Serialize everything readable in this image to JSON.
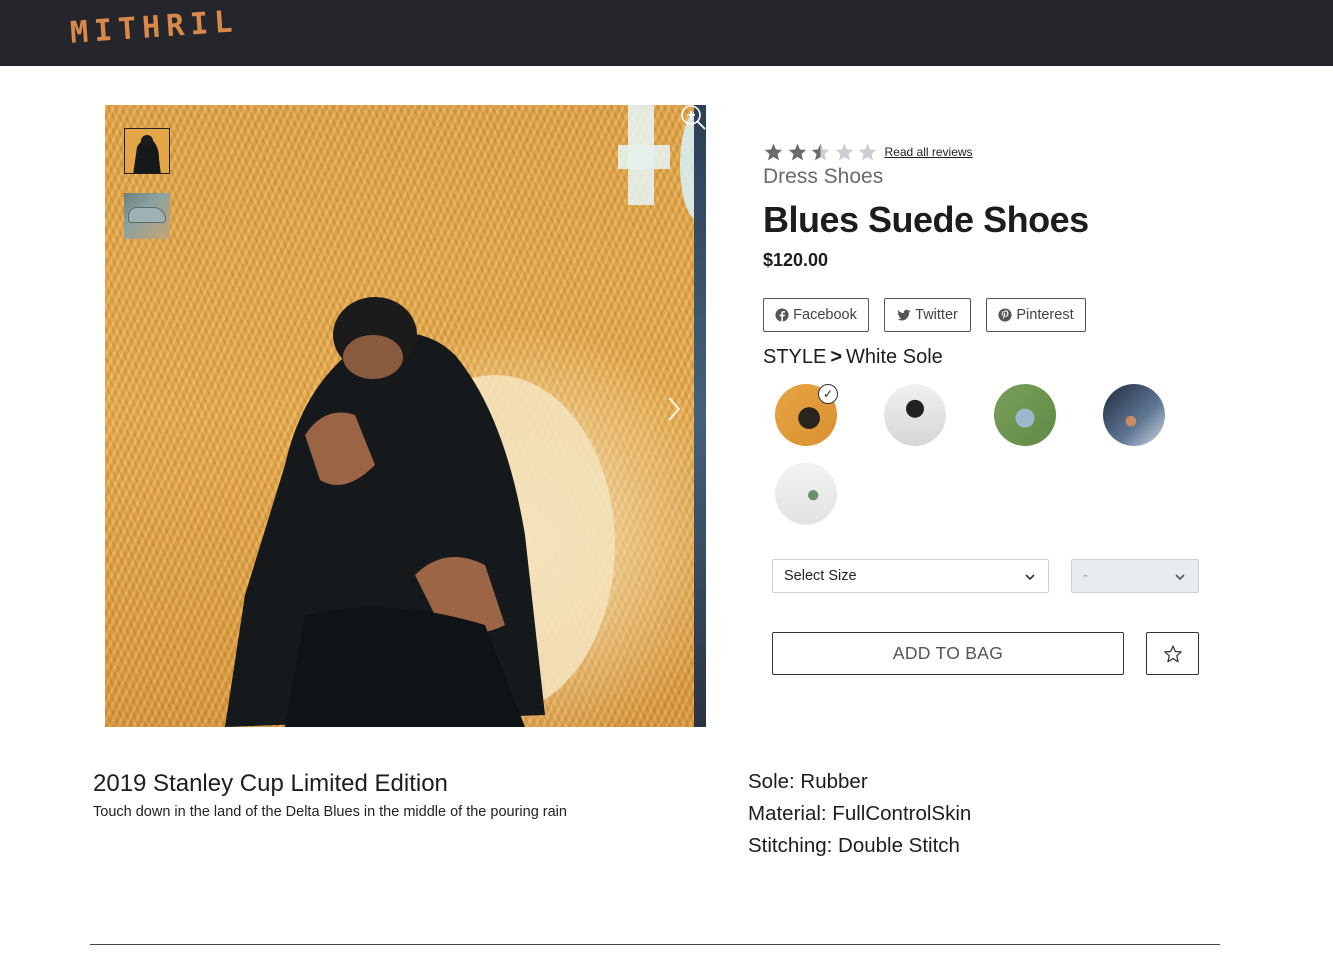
{
  "header": {
    "logo_text": "MITHRIL"
  },
  "gallery": {
    "thumbnails": [
      "thumbnail-person",
      "thumbnail-shoe"
    ],
    "zoom_icon": "zoom-in-icon",
    "next_icon": "chevron-right-icon"
  },
  "product": {
    "rating": 2.5,
    "rating_max": 5,
    "reviews_link": "Read all reviews",
    "category": "Dress Shoes",
    "name": "Blues Suede Shoes",
    "price": "$120.00"
  },
  "share": {
    "facebook": "Facebook",
    "twitter": "Twitter",
    "pinterest": "Pinterest"
  },
  "style": {
    "label": "STYLE",
    "separator": ">",
    "selected": "White Sole",
    "swatch_count": 5,
    "selected_index": 0
  },
  "size_select": {
    "value": "Select Size"
  },
  "qty_select": {
    "value": "-"
  },
  "actions": {
    "add_to_bag": "ADD TO BAG",
    "favorite_icon": "star-outline-icon"
  },
  "description": {
    "title": "2019 Stanley Cup Limited Edition",
    "text": "Touch down in the land of the Delta Blues in the middle of the pouring rain"
  },
  "specs": [
    "Sole: Rubber",
    "Material: FullControlSkin",
    "Stitching: Double Stitch"
  ],
  "colors": {
    "topbar": "#25262b",
    "logo": "#d9894a",
    "star_filled": "#6b6b6b",
    "star_empty": "#c9ccd3"
  }
}
